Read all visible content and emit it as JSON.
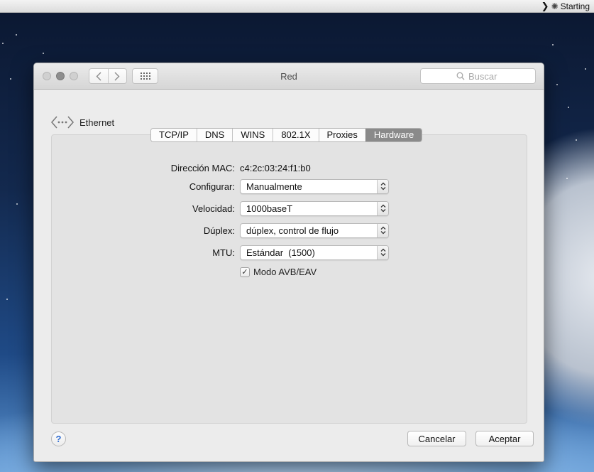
{
  "menubar": {
    "status_text": "Starting"
  },
  "window": {
    "title": "Red",
    "search_placeholder": "Buscar"
  },
  "breadcrumb": {
    "label": "Ethernet"
  },
  "tabs": [
    {
      "label": "TCP/IP",
      "active": false
    },
    {
      "label": "DNS",
      "active": false
    },
    {
      "label": "WINS",
      "active": false
    },
    {
      "label": "802.1X",
      "active": false
    },
    {
      "label": "Proxies",
      "active": false
    },
    {
      "label": "Hardware",
      "active": true
    }
  ],
  "hardware": {
    "mac_label": "Dirección MAC:",
    "mac_value": "c4:2c:03:24:f1:b0",
    "configure_label": "Configurar:",
    "configure_value": "Manualmente",
    "speed_label": "Velocidad:",
    "speed_value": "1000baseT",
    "duplex_label": "Dúplex:",
    "duplex_value": "dúplex, control de flujo",
    "mtu_label": "MTU:",
    "mtu_value": "Estándar  (1500)",
    "avb_label": "Modo AVB/EAV",
    "avb_checked": true
  },
  "footer": {
    "help_label": "?",
    "cancel_label": "Cancelar",
    "ok_label": "Aceptar"
  }
}
